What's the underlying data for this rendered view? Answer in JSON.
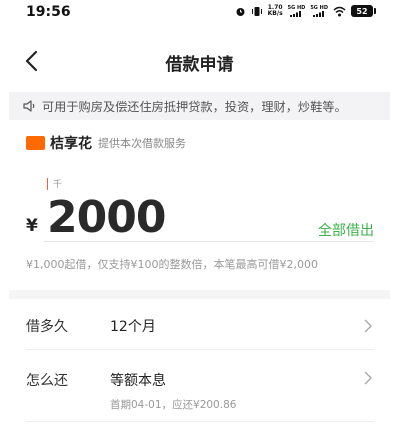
{
  "status_bar": {
    "time": "19:56",
    "speed_value": "1.70",
    "speed_unit": "KB/s",
    "net1": "5G HD",
    "net2": "5G HD",
    "battery": "52"
  },
  "nav": {
    "title": "借款申请"
  },
  "notice": {
    "text": "可用于购房及偿还住房抵押贷款，投资，理财，炒鞋等。"
  },
  "provider": {
    "name": "桔享花",
    "description": "提供本次借款服务"
  },
  "amount": {
    "unit_hint": "千",
    "currency": "¥",
    "value": "2000",
    "borrow_all_label": "全部借出"
  },
  "hint": "¥1,000起借，仅支持¥100的整数倍，本笔最高可借¥2,000",
  "rows": [
    {
      "label": "借多久",
      "value": "12个月",
      "sub": ""
    },
    {
      "label": "怎么还",
      "value": "等额本息",
      "sub": "首期04-01，应还¥200.86"
    }
  ],
  "icons": {
    "back": "back-arrow-icon",
    "speaker": "speaker-icon",
    "chevron": "chevron-right-icon"
  },
  "colors": {
    "accent_green": "#3bb24a",
    "brand_orange": "#ff6a00",
    "cursor_red": "#ff5a3c"
  }
}
